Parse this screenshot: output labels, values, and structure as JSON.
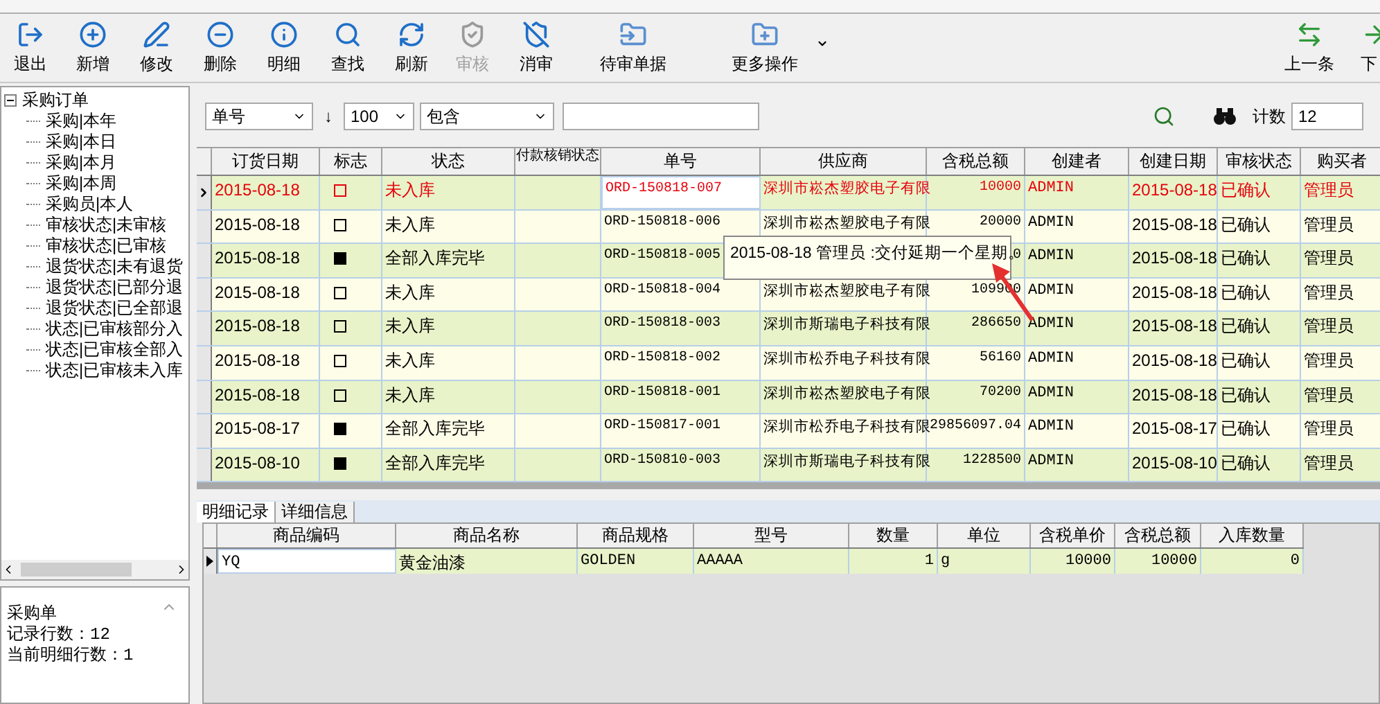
{
  "toolbar": [
    {
      "label": "退出",
      "disabled": false,
      "kind": "button"
    },
    {
      "label": "新增",
      "disabled": false,
      "kind": "button"
    },
    {
      "label": "修改",
      "disabled": false,
      "kind": "button"
    },
    {
      "label": "删除",
      "disabled": false,
      "kind": "button"
    },
    {
      "label": "明细",
      "disabled": false,
      "kind": "button"
    },
    {
      "label": "查找",
      "disabled": false,
      "kind": "button"
    },
    {
      "label": "刷新",
      "disabled": false,
      "kind": "button"
    },
    {
      "label": "审核",
      "disabled": true,
      "kind": "button"
    },
    {
      "label": "消审",
      "disabled": false,
      "kind": "button"
    },
    {
      "label": "待审单据",
      "disabled": false,
      "kind": "button"
    },
    {
      "label": "更多操作",
      "disabled": false,
      "kind": "menu"
    }
  ],
  "nav_buttons": [
    "上一条",
    "下"
  ],
  "tree": {
    "label": "采购订单",
    "expanded": true,
    "children": [
      {
        "label": "采购|本年"
      },
      {
        "label": "采购|本日"
      },
      {
        "label": "采购|本月"
      },
      {
        "label": "采购|本周"
      },
      {
        "label": "采购员|本人"
      },
      {
        "label": "审核状态|未审核"
      },
      {
        "label": "审核状态|已审核"
      },
      {
        "label": "退货状态|未有退货"
      },
      {
        "label": "退货状态|已部分退"
      },
      {
        "label": "退货状态|已全部退"
      },
      {
        "label": "状态|已审核部分入"
      },
      {
        "label": "状态|已审核全部入"
      },
      {
        "label": "状态|已审核未入库"
      }
    ]
  },
  "info": [
    "采购单",
    "记录行数：12",
    "当前明细行数：1"
  ],
  "filter": {
    "field": "单号",
    "direction": "↓",
    "limit": "100",
    "operator": "包含",
    "count_label": "计数",
    "count": "12"
  },
  "grid": {
    "columns": [
      {
        "title": "订货日期",
        "kind": "text",
        "focused": false
      },
      {
        "title": "标志",
        "kind": "flag",
        "focused": false
      },
      {
        "title": "状态",
        "kind": "text",
        "focused": false
      },
      {
        "title": "付款核销状态",
        "kind": "text",
        "focused": false
      },
      {
        "title": "单号",
        "kind": "mono",
        "focused": true
      },
      {
        "title": "供应商",
        "kind": "text",
        "focused": false
      },
      {
        "title": "含税总额",
        "kind": "num",
        "focused": false
      },
      {
        "title": "创建者",
        "kind": "mono",
        "focused": false
      },
      {
        "title": "创建日期",
        "kind": "text",
        "focused": false
      },
      {
        "title": "审核状态",
        "kind": "text",
        "focused": false
      },
      {
        "title": "购买者",
        "kind": "text",
        "focused": false
      }
    ],
    "rows": [
      {
        "selected": true,
        "flagged": false,
        "cells": [
          "2015-08-18",
          null,
          "未入库",
          null,
          "ORD-150818-007",
          "深圳市崧杰塑胶电子有限",
          "10000",
          "ADMIN",
          "2015-08-18",
          "已确认",
          "管理员"
        ]
      },
      {
        "selected": false,
        "flagged": false,
        "cells": [
          "2015-08-18",
          null,
          "未入库",
          null,
          "ORD-150818-006",
          "深圳市崧杰塑胶电子有限",
          "20000",
          "ADMIN",
          "2015-08-18",
          "已确认",
          "管理员"
        ]
      },
      {
        "selected": false,
        "flagged": true,
        "cells": [
          "2015-08-18",
          null,
          "全部入库完毕",
          null,
          "ORD-150818-005",
          null,
          "0",
          "ADMIN",
          "2015-08-18",
          "已确认",
          "管理员"
        ]
      },
      {
        "selected": false,
        "flagged": false,
        "cells": [
          "2015-08-18",
          null,
          "未入库",
          null,
          "ORD-150818-004",
          "深圳市崧杰塑胶电子有限",
          "109900",
          "ADMIN",
          "2015-08-18",
          "已确认",
          "管理员"
        ]
      },
      {
        "selected": false,
        "flagged": false,
        "cells": [
          "2015-08-18",
          null,
          "未入库",
          null,
          "ORD-150818-003",
          "深圳市斯瑞电子科技有限",
          "286650",
          "ADMIN",
          "2015-08-18",
          "已确认",
          "管理员"
        ]
      },
      {
        "selected": false,
        "flagged": false,
        "cells": [
          "2015-08-18",
          null,
          "未入库",
          null,
          "ORD-150818-002",
          "深圳市松乔电子科技有限",
          "56160",
          "ADMIN",
          "2015-08-18",
          "已确认",
          "管理员"
        ]
      },
      {
        "selected": false,
        "flagged": false,
        "cells": [
          "2015-08-18",
          null,
          "未入库",
          null,
          "ORD-150818-001",
          "深圳市崧杰塑胶电子有限",
          "70200",
          "ADMIN",
          "2015-08-18",
          "已确认",
          "管理员"
        ]
      },
      {
        "selected": false,
        "flagged": true,
        "cells": [
          "2015-08-17",
          null,
          "全部入库完毕",
          null,
          "ORD-150817-001",
          "深圳市松乔电子科技有限",
          "29856097.04",
          "ADMIN",
          "2015-08-17",
          "已确认",
          "管理员"
        ]
      },
      {
        "selected": false,
        "flagged": true,
        "cells": [
          "2015-08-10",
          null,
          "全部入库完毕",
          null,
          "ORD-150810-003",
          "深圳市斯瑞电子科技有限",
          "1228500",
          "ADMIN",
          "2015-08-10",
          "已确认",
          "管理员"
        ]
      }
    ],
    "tooltip": "2015-08-18 管理员 :交付延期一个星期。"
  },
  "detail_tabs": [
    {
      "label": "明细记录",
      "selected": true
    },
    {
      "label": "详细信息",
      "selected": false
    }
  ],
  "detail_grid": {
    "columns": [
      {
        "title": "商品编码",
        "kind": "mono",
        "focused": true
      },
      {
        "title": "商品名称",
        "kind": "text",
        "focused": false
      },
      {
        "title": "商品规格",
        "kind": "mono",
        "focused": false
      },
      {
        "title": "型号",
        "kind": "mono",
        "focused": false
      },
      {
        "title": "数量",
        "kind": "num",
        "focused": false
      },
      {
        "title": "单位",
        "kind": "mono",
        "focused": false
      },
      {
        "title": "含税单价",
        "kind": "num",
        "focused": false
      },
      {
        "title": "含税总额",
        "kind": "num",
        "focused": false
      },
      {
        "title": "入库数量",
        "kind": "num",
        "focused": false
      }
    ],
    "rows": [
      {
        "selected": true,
        "cells": [
          "YQ",
          "黄金油漆",
          "GOLDEN",
          "AAAAA",
          "1",
          "g",
          "10000",
          "10000",
          "0"
        ]
      }
    ]
  }
}
